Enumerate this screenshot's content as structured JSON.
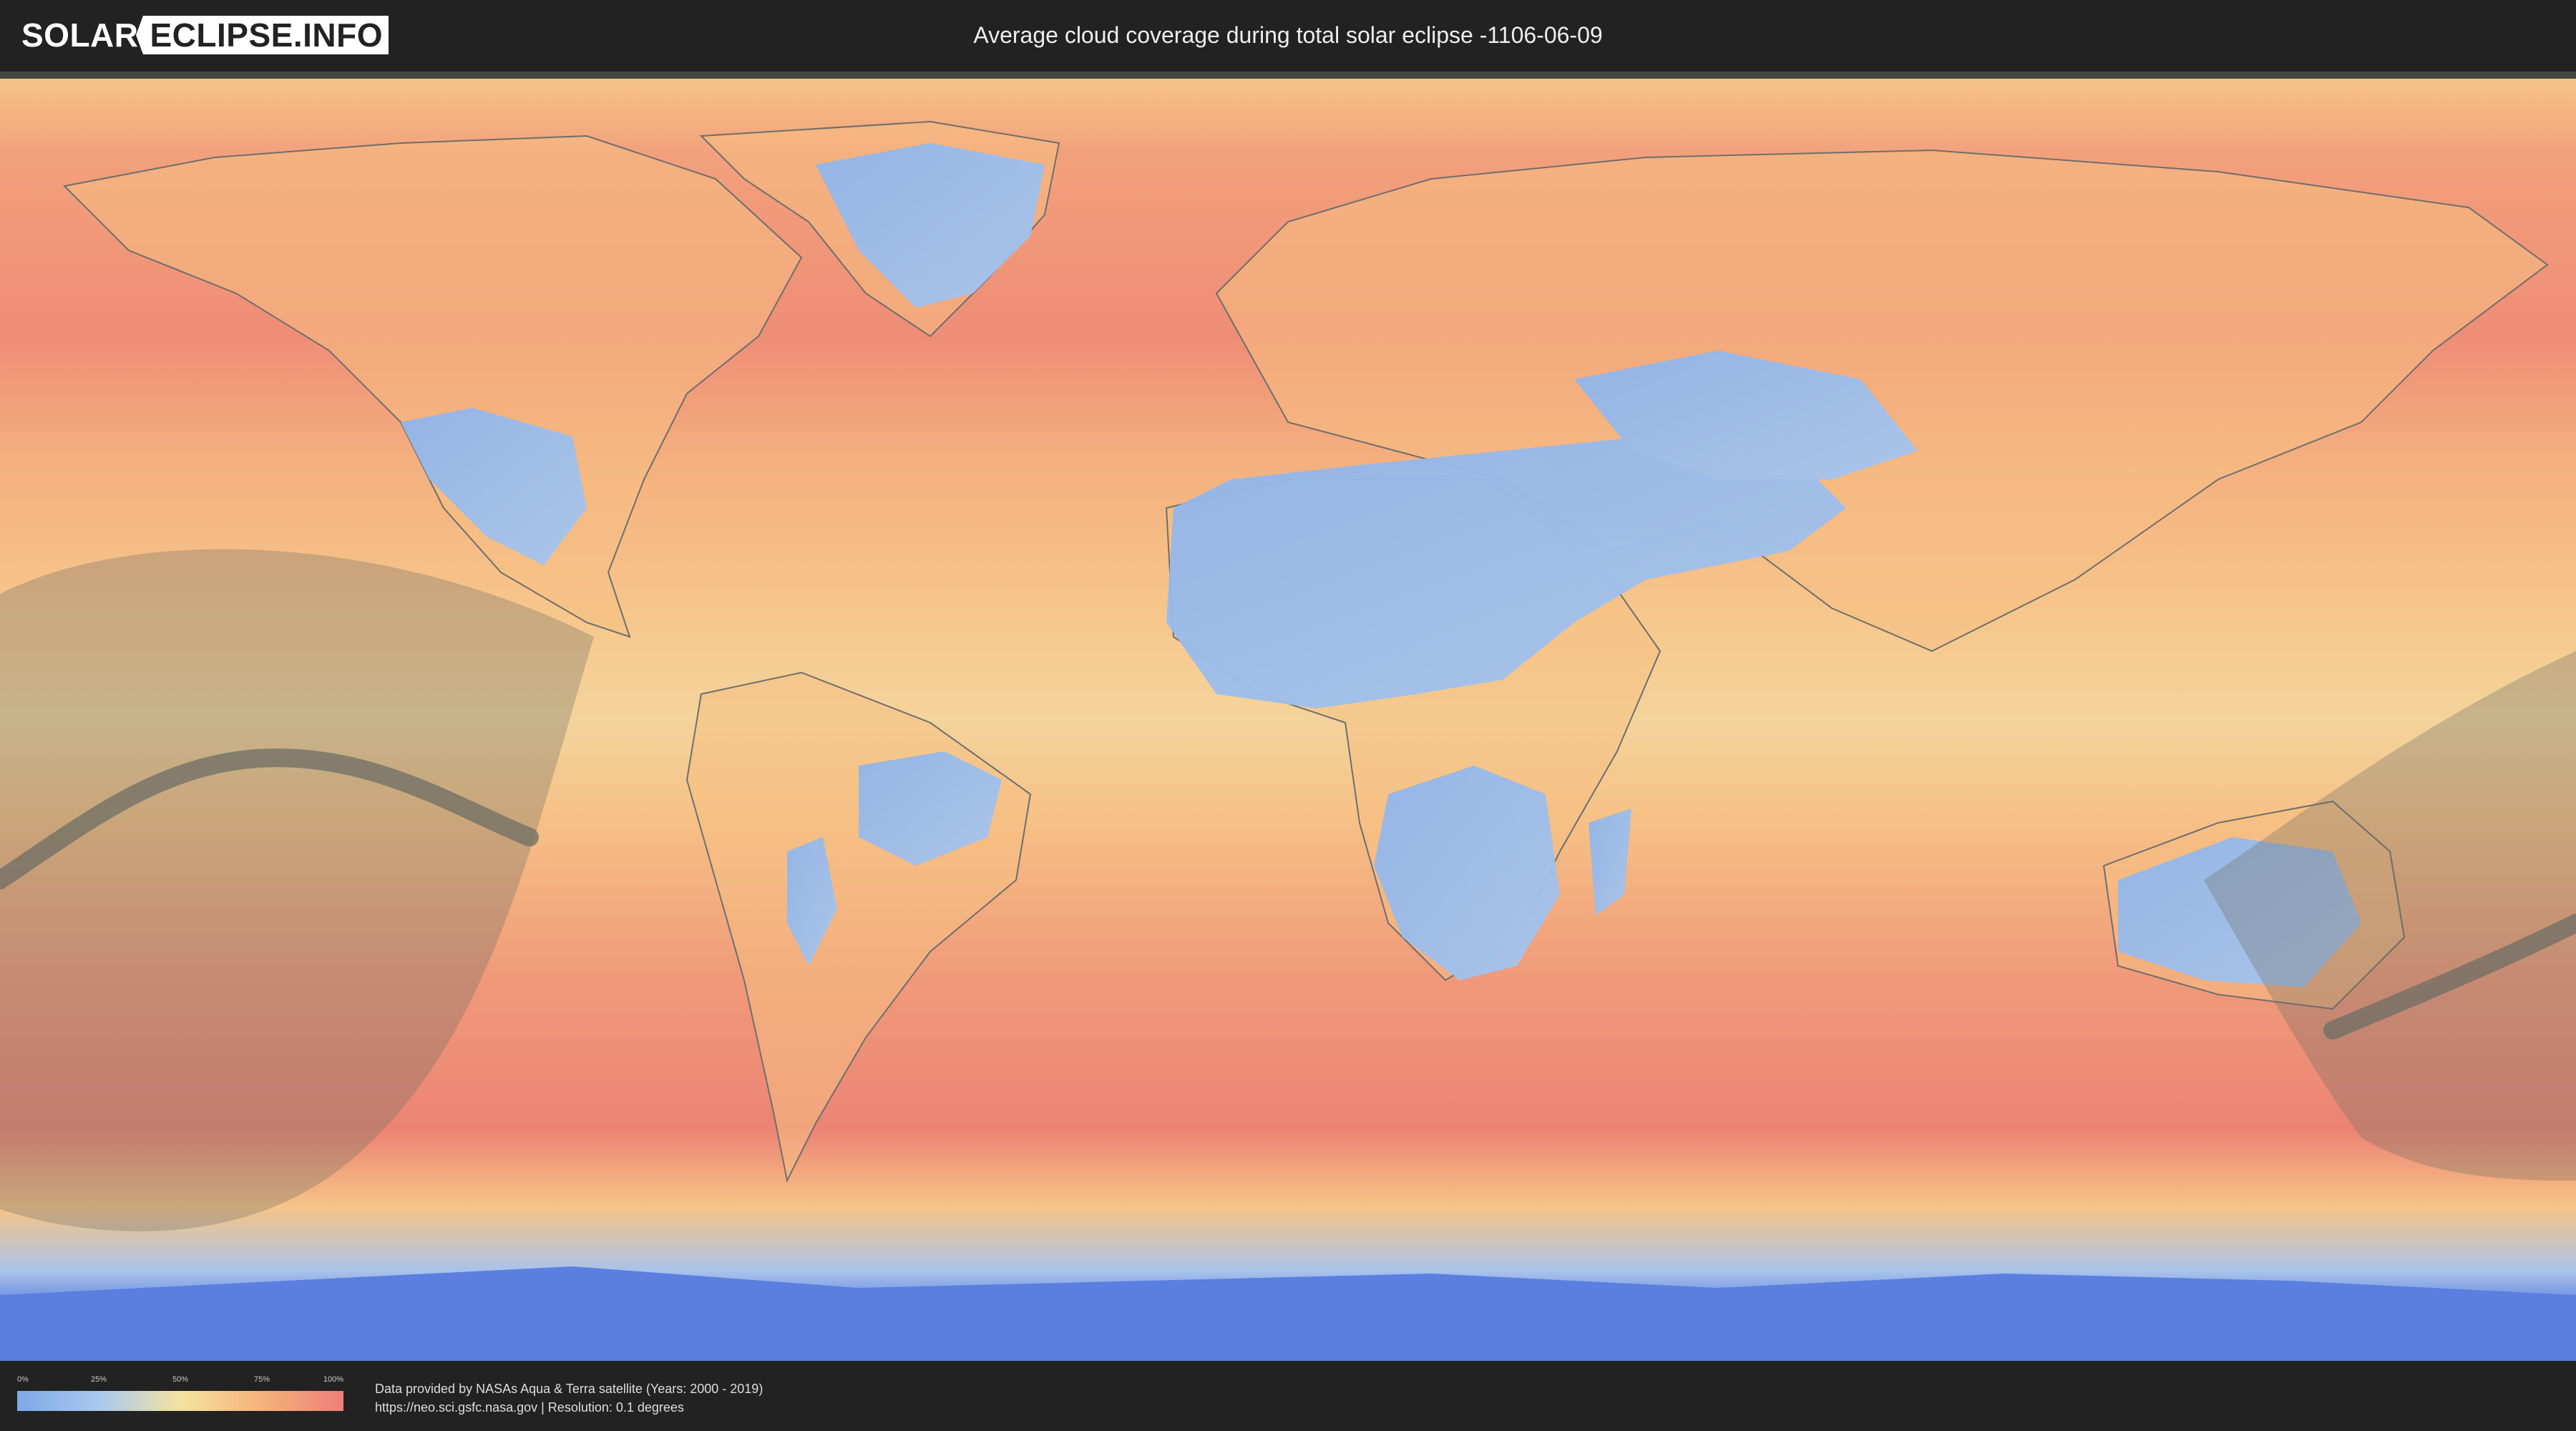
{
  "header": {
    "logo_left": "SOLAR",
    "logo_right": "ECLIPSE.INFO",
    "title": "Average cloud coverage during total solar eclipse -1106-06-09"
  },
  "legend": {
    "ticks": [
      "0%",
      "25%",
      "50%",
      "75%",
      "100%"
    ],
    "colors": [
      "#7fa8e8",
      "#a9c8ee",
      "#f3e3a0",
      "#f5b27a",
      "#ee7e7a"
    ]
  },
  "credit": {
    "line1": "Data provided by NASAs Aqua & Terra satellite (Years: 2000 - 2019)",
    "line2": "https://neo.sci.gsfc.nasa.gov | Resolution: 0.1 degrees"
  },
  "map": {
    "projection": "equirectangular",
    "colors": {
      "ocean_cloudy": "#ee8a72",
      "mid": "#f6c487",
      "clear": "#8fb4ea",
      "polar": "#5a7fe0",
      "land_outline": "#6e6e6e",
      "eclipse_shadow": "#6e6e64"
    }
  }
}
